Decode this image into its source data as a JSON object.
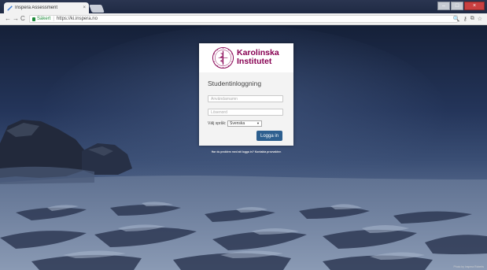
{
  "browser": {
    "tab_title": "Inspera Assessment",
    "tab_close": "×",
    "nav": {
      "back": "←",
      "forward": "→",
      "reload": "C"
    },
    "secure_label": "Säkert",
    "separator": "|",
    "url": "https://ki.inspera.no",
    "window_controls": {
      "minimize": "–",
      "maximize": "□",
      "close": "×"
    },
    "toolbar_icons": {
      "zoom": "🔍",
      "key": "⚷",
      "cast": "⧉",
      "star": "☆"
    }
  },
  "logo": {
    "line1": "Karolinska",
    "line2": "Institutet"
  },
  "login": {
    "title": "Studentinloggning",
    "username_placeholder": "Användarnamn",
    "password_placeholder": "Lösenord",
    "language_label": "Välj språk:",
    "language_selected": "Svenska",
    "submit_label": "Logga in"
  },
  "help_link": "Har du problem med att logga in? Kontakta provvakten",
  "photo_credit": "Photo by Inspera Roberts",
  "colors": {
    "brand": "#870052",
    "button": "#2d5f8f",
    "secure": "#1e8a3a"
  }
}
